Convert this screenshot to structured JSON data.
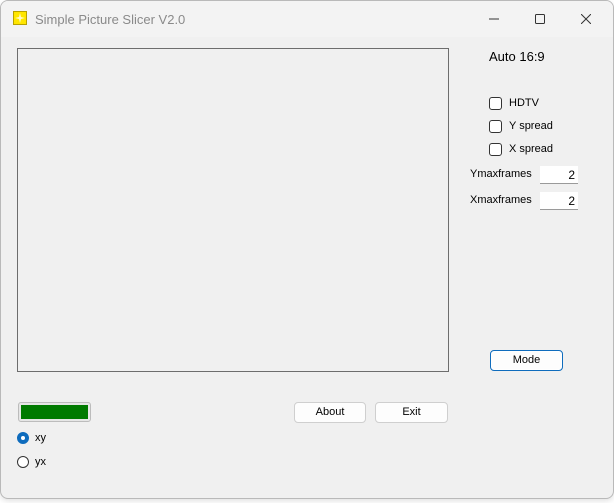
{
  "window": {
    "title": "Simple Picture Slicer V2.0",
    "icon": "app-icon"
  },
  "titlebar": {
    "minimize_icon": "minimize-icon",
    "maximize_icon": "maximize-icon",
    "close_icon": "close-icon"
  },
  "right_panel": {
    "mode_label": "Auto 16:9",
    "checkboxes": [
      {
        "label": "HDTV",
        "checked": false
      },
      {
        "label": "Y spread",
        "checked": false
      },
      {
        "label": "X spread",
        "checked": false
      }
    ],
    "fields": [
      {
        "label": "Ymaxframes",
        "value": "2"
      },
      {
        "label": "Xmaxframes",
        "value": "2"
      }
    ],
    "mode_button": "Mode"
  },
  "bottom": {
    "progress_fraction": 1.0,
    "progress_color": "#007a00",
    "about_button": "About",
    "exit_button": "Exit",
    "radios": [
      {
        "label": "xy",
        "selected": true
      },
      {
        "label": "yx",
        "selected": false
      }
    ]
  },
  "colors": {
    "accent": "#0f6cbd",
    "window_bg": "#f0f0f0"
  }
}
